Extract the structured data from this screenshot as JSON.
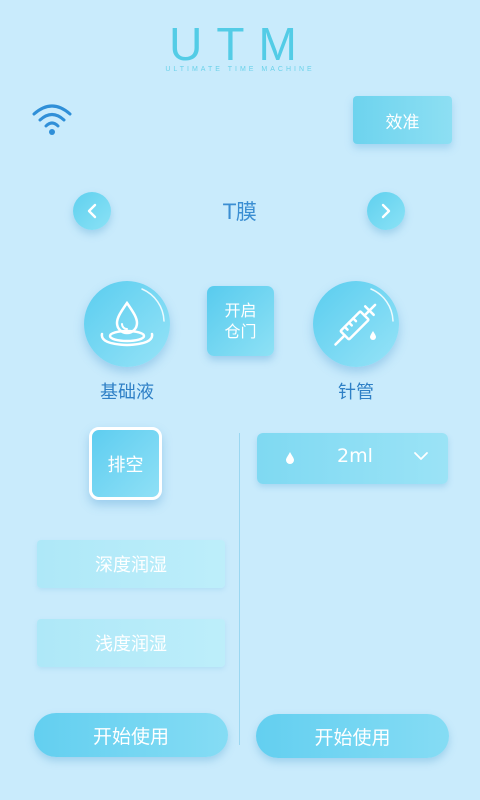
{
  "header": {
    "logo_text": "UTM",
    "logo_subtitle": "ULTIMATE TIME MACHINE",
    "calibrate_label": "效准",
    "icons": [
      "wifi-icon"
    ]
  },
  "mode_selector": {
    "title": "T膜",
    "icons": [
      "chevron-left-icon",
      "chevron-right-icon"
    ]
  },
  "actions": {
    "door_label_line1": "开启",
    "door_label_line2": "仓门",
    "fluid_label": "基础液",
    "needle_label": "针管"
  },
  "left_panel": {
    "drain_label": "排空",
    "deep_label": "深度润湿",
    "shallow_label": "浅度润湿",
    "start_label": "开始使用"
  },
  "right_panel": {
    "volume_value": "2ml",
    "start_label": "开始使用",
    "icons": [
      "droplet-icon",
      "chevron-down-icon"
    ]
  },
  "colors": {
    "background": "#c9ebfc",
    "accent": "#5fd0ee",
    "text": "#2f80c6"
  }
}
